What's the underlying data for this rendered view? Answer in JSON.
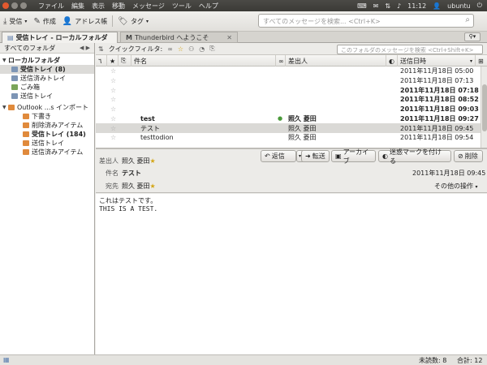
{
  "menubar": {
    "items": [
      "ファイル",
      "編集",
      "表示",
      "移動",
      "メッセージ",
      "ツール",
      "ヘルプ"
    ],
    "time": "11:12",
    "user": "ubuntu"
  },
  "toolbar": {
    "receive": "受信",
    "compose": "作成",
    "addressbook": "アドレス帳",
    "tag": "タグ",
    "search_placeholder": "すべてのメッセージを検索... <Ctrl+K>"
  },
  "tabs": [
    {
      "label": "受信トレイ - ローカルフォルダ"
    },
    {
      "label": "Thunderbird へようこそ"
    }
  ],
  "folder_pane": {
    "header": "すべてのフォルダ",
    "folders": [
      {
        "label": "ローカルフォルダ",
        "bold": true,
        "icon": "folder-icon"
      },
      {
        "label": "受信トレイ (8)",
        "bold": true,
        "icon": "inbox-icon"
      },
      {
        "label": "送信済みトレイ",
        "bold": false,
        "icon": "sent-icon"
      },
      {
        "label": "ごみ箱",
        "bold": false,
        "icon": "trash-icon"
      },
      {
        "label": "送信トレイ",
        "bold": false,
        "icon": "outbox-icon"
      },
      {
        "label": "Outlook ...s インポート",
        "bold": false,
        "icon": "folder-icon"
      },
      {
        "label": "下書き",
        "bold": false,
        "icon": "folder-icon"
      },
      {
        "label": "削除済みアイテム",
        "bold": false,
        "icon": "folder-icon"
      },
      {
        "label": "受信トレイ (184)",
        "bold": true,
        "icon": "folder-icon"
      },
      {
        "label": "送信トレイ",
        "bold": false,
        "icon": "folder-icon"
      },
      {
        "label": "送信済みアイテム",
        "bold": false,
        "icon": "folder-icon"
      }
    ]
  },
  "quick_filter": {
    "label": "クイックフィルタ:",
    "placeholder": "このフォルダのメッセージを検索 <Ctrl+Shift+K>"
  },
  "columns": {
    "subject": "件名",
    "from": "差出人",
    "date": "送信日時"
  },
  "messages": [
    {
      "subject": "",
      "from": "",
      "date": "2011年11月18日 05:00",
      "bold": false,
      "dot": false
    },
    {
      "subject": "",
      "from": "",
      "date": "2011年11月18日 07:13",
      "bold": false,
      "dot": false
    },
    {
      "subject": "",
      "from": "",
      "date": "2011年11月18日 07:18",
      "bold": true,
      "dot": false
    },
    {
      "subject": "",
      "from": "",
      "date": "2011年11月18日 08:52",
      "bold": true,
      "dot": false
    },
    {
      "subject": "",
      "from": "",
      "date": "2011年11月18日 09:03",
      "bold": true,
      "dot": false
    },
    {
      "subject": "test",
      "from": "照久 菱田",
      "date": "2011年11月18日 09:27",
      "bold": true,
      "dot": true
    },
    {
      "subject": "テスト",
      "from": "照久 菱田",
      "date": "2011年11月18日 09:45",
      "bold": false,
      "dot": false
    },
    {
      "subject": "testtodion",
      "from": "照久 菱田",
      "date": "2011年11月18日 09:54",
      "bold": false,
      "dot": false
    }
  ],
  "header_pane": {
    "buttons": {
      "reply": "返信",
      "forward": "転送",
      "archive": "アーカイブ",
      "junk": "迷惑マークを付ける",
      "delete": "削除"
    },
    "from_label": "差出人",
    "from_value": "照久 菱田",
    "subject_label": "件名",
    "subject_value": "テスト",
    "to_label": "宛先",
    "to_value": "照久 菱田",
    "date": "2011年11月18日 09:45",
    "other_actions": "その他の操作"
  },
  "body": {
    "line1": "これはテストです。",
    "line2": "THIS IS A TEST."
  },
  "status": {
    "unread": "未読数: 8",
    "total": "合計: 12"
  }
}
